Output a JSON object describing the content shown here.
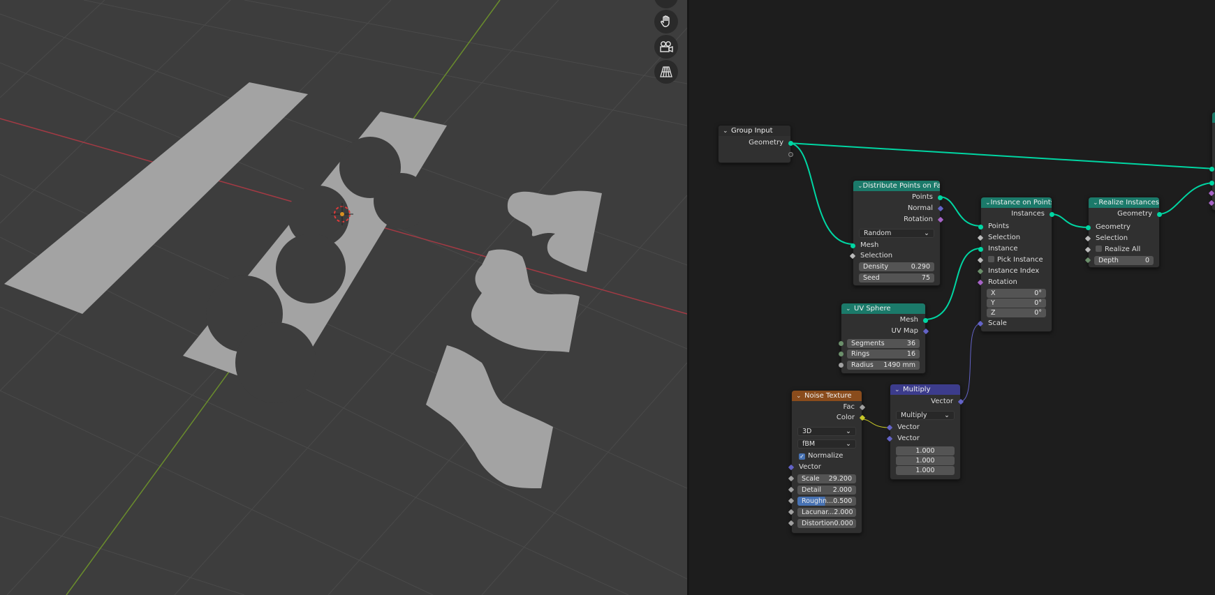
{
  "viewport": {
    "tools": [
      {
        "icon": "hand-pan-icon"
      },
      {
        "icon": "camera-icon"
      },
      {
        "icon": "grid-perspective-icon"
      }
    ]
  },
  "nodes": {
    "group_input": {
      "title": "Group Input",
      "geometry": "Geometry"
    },
    "distribute": {
      "title": "Distribute Points on Fa...",
      "points": "Points",
      "normal": "Normal",
      "rotation": "Rotation",
      "mode": "Random",
      "mesh": "Mesh",
      "selection": "Selection",
      "density_label": "Density",
      "density": "0.290",
      "seed_label": "Seed",
      "seed": "75"
    },
    "instance_on_points": {
      "title": "Instance on Points",
      "instances": "Instances",
      "points": "Points",
      "selection": "Selection",
      "instance": "Instance",
      "pick_instance": "Pick Instance",
      "instance_index": "Instance Index",
      "rotation": "Rotation",
      "x_label": "X",
      "x": "0°",
      "y_label": "Y",
      "y": "0°",
      "z_label": "Z",
      "z": "0°",
      "scale": "Scale"
    },
    "realize": {
      "title": "Realize Instances",
      "geometry_out": "Geometry",
      "geometry_in": "Geometry",
      "selection": "Selection",
      "realize_all": "Realize All",
      "depth_label": "Depth",
      "depth": "0"
    },
    "uv_sphere": {
      "title": "UV Sphere",
      "mesh": "Mesh",
      "uv_map": "UV Map",
      "segments_label": "Segments",
      "segments": "36",
      "rings_label": "Rings",
      "rings": "16",
      "radius_label": "Radius",
      "radius": "1490 mm"
    },
    "noise": {
      "title": "Noise Texture",
      "fac": "Fac",
      "color": "Color",
      "dim": "3D",
      "type": "fBM",
      "normalize": "Normalize",
      "vector": "Vector",
      "scale_label": "Scale",
      "scale": "29.200",
      "detail_label": "Detail",
      "detail": "2.000",
      "roughness_label": "Roughn...",
      "roughness": "0.500",
      "lacunarity_label": "Lacunar...",
      "lacunarity": "2.000",
      "distortion_label": "Distortion",
      "distortion": "0.000"
    },
    "multiply": {
      "title": "Multiply",
      "vector_out": "Vector",
      "op": "Multiply",
      "vector_a": "Vector",
      "vector_b": "Vector",
      "v1": "1.000",
      "v2": "1.000",
      "v3": "1.000"
    }
  },
  "colors": {
    "geometry_socket": "#00d6a3",
    "vector_socket": "#6363c7",
    "color_socket": "#c7c729",
    "float_socket": "#a1a1a1",
    "rotation_socket": "#a663c7"
  }
}
